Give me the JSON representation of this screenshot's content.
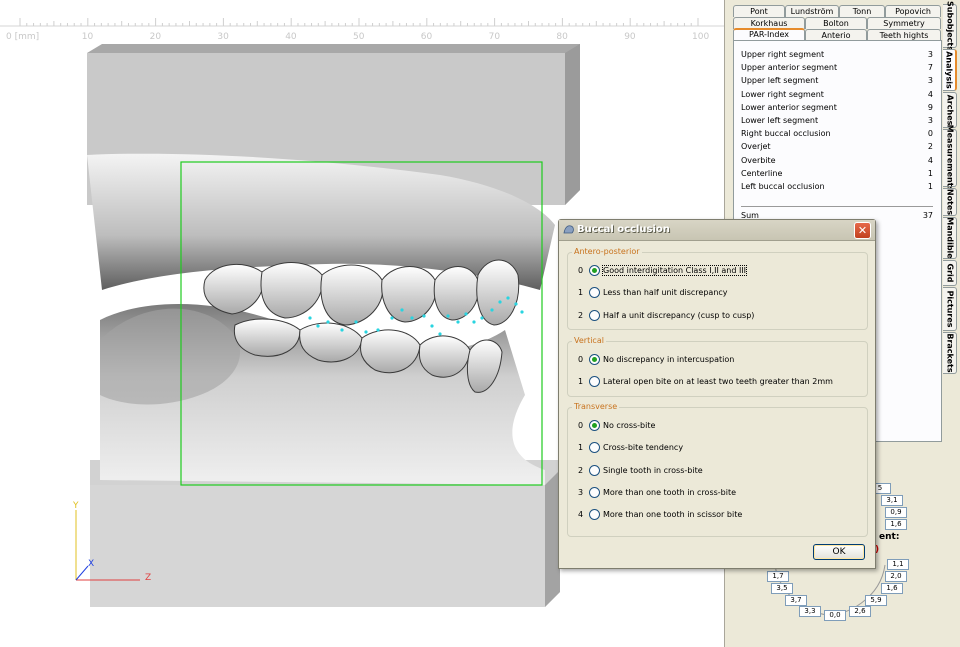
{
  "ruler": {
    "ticks": [
      "0 [mm]",
      "10",
      "20",
      "30",
      "40",
      "50",
      "60",
      "70",
      "80",
      "90",
      "100"
    ]
  },
  "axes": {
    "x": "X",
    "y": "Y",
    "z": "Z"
  },
  "colors": {
    "accent_tab": "#e68b2c",
    "selection_box": "#1ecb1e",
    "landmark": "#29d4e0",
    "group_title": "#c8731e",
    "radio_checked": "#21a121"
  },
  "top_tabs": {
    "row1": [
      "Pont",
      "Lundström",
      "Tonn",
      "Popovich"
    ],
    "row2": [
      "Korkhaus",
      "Bolton",
      "Symmetry"
    ],
    "row3": [
      "PAR-Index",
      "Anterio",
      "Teeth hights"
    ]
  },
  "side_tabs": [
    "Subobjects",
    "Analysis",
    "Arches",
    "Measurements",
    "Notes",
    "Mandible",
    "Grid",
    "Pictures",
    "Brackets"
  ],
  "par_index": {
    "rows": [
      {
        "label": "Upper right segment",
        "value": "3"
      },
      {
        "label": "Upper anterior segment",
        "value": "7"
      },
      {
        "label": "Upper left segment",
        "value": "3"
      },
      {
        "label": "Lower right segment",
        "value": "4"
      },
      {
        "label": "Lower anterior segment",
        "value": "9"
      },
      {
        "label": "Lower left segment",
        "value": "3"
      },
      {
        "label": "Right buccal occlusion",
        "value": "0"
      },
      {
        "label": "Overjet",
        "value": "2"
      },
      {
        "label": "Overbite",
        "value": "4"
      },
      {
        "label": "Centerline",
        "value": "1"
      },
      {
        "label": "Left buccal occlusion",
        "value": "1"
      }
    ],
    "sum_label": "Sum",
    "sum_value": "37"
  },
  "measurements": {
    "upper": [
      "5",
      "3,1",
      "0,9",
      "1,6"
    ],
    "label_fragment": "ent:",
    "red_fragment": ")",
    "lower_right": [
      "1,1",
      "2,0",
      "1,6",
      "5,9",
      "2,6"
    ],
    "lower_left": [
      "1,7",
      "3,5",
      "3,7",
      "3,3",
      "0,0"
    ]
  },
  "dialog": {
    "title": "Buccal occlusion",
    "close": "✕",
    "ok": "OK",
    "groups": [
      {
        "title": "Antero-posterior",
        "options": [
          {
            "num": "0",
            "text": "Good interdigitation Class I,II and III",
            "checked": true
          },
          {
            "num": "1",
            "text": "Less than half unit discrepancy",
            "checked": false
          },
          {
            "num": "2",
            "text": "Half a unit discrepancy (cusp to cusp)",
            "checked": false
          }
        ]
      },
      {
        "title": "Vertical",
        "options": [
          {
            "num": "0",
            "text": "No discrepancy in intercuspation",
            "checked": true
          },
          {
            "num": "1",
            "text": "Lateral open bite on at least two teeth greater than 2mm",
            "checked": false
          }
        ]
      },
      {
        "title": "Transverse",
        "options": [
          {
            "num": "0",
            "text": "No cross-bite",
            "checked": true
          },
          {
            "num": "1",
            "text": "Cross-bite tendency",
            "checked": false
          },
          {
            "num": "2",
            "text": "Single tooth in cross-bite",
            "checked": false
          },
          {
            "num": "3",
            "text": "More than one tooth in cross-bite",
            "checked": false
          },
          {
            "num": "4",
            "text": "More than one tooth in scissor bite",
            "checked": false
          }
        ]
      }
    ]
  }
}
